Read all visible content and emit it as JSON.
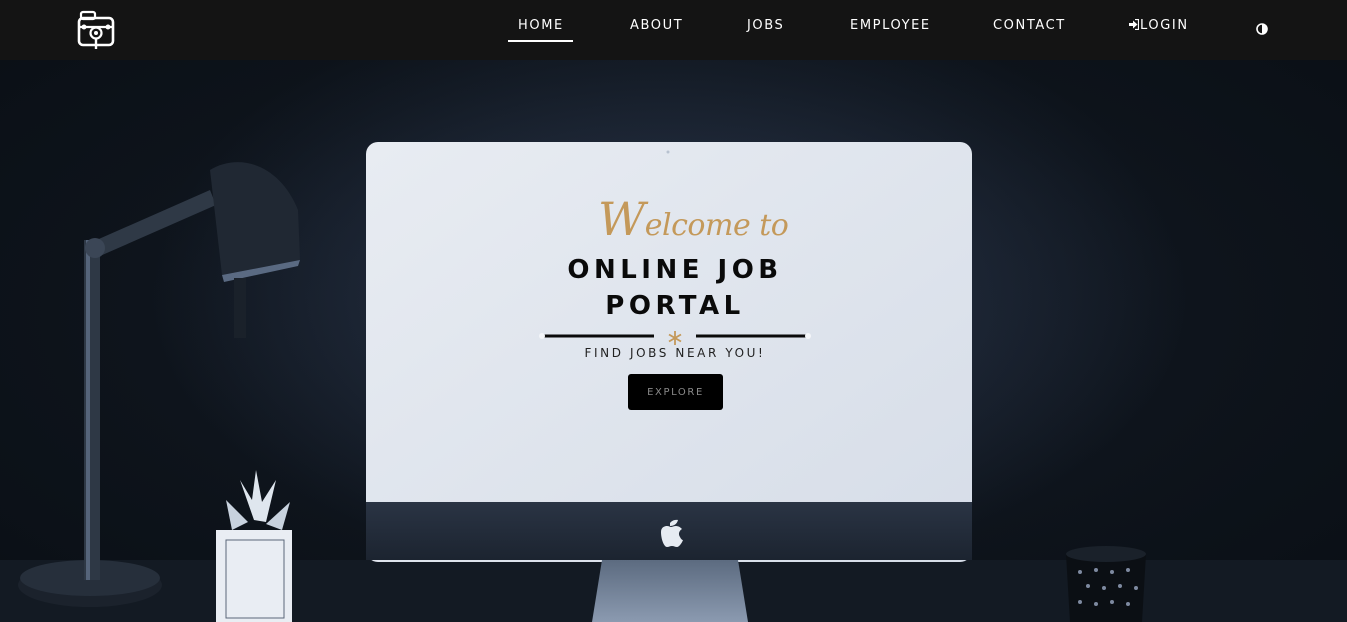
{
  "nav": {
    "items": [
      {
        "label": "HOME",
        "active": true
      },
      {
        "label": "ABOUT"
      },
      {
        "label": "JOBS"
      },
      {
        "label": "EMPLOYEE"
      },
      {
        "label": "CONTACT"
      },
      {
        "label": "LOGIN",
        "icon": "sign-in-icon"
      }
    ],
    "logo_icon": "briefcase-search-icon",
    "theme_icon": "contrast-toggle-icon"
  },
  "hero": {
    "welcome_cap": "W",
    "welcome_rest": "elcome to",
    "title_line1": "ONLINE JOB",
    "title_line2": "PORTAL",
    "divider_icon": "asterisk-icon",
    "subtitle": "FIND JOBS NEAR YOU!",
    "cta_label": "EXPLORE",
    "background_image": "desk-with-computer-lamp-plant-mug"
  },
  "colors": {
    "navbar_bg": "#141414",
    "accent_gold": "#c4995a",
    "hero_bg": "#0e141c",
    "screen_white": "#dde3ec",
    "cta_bg": "#000000"
  }
}
